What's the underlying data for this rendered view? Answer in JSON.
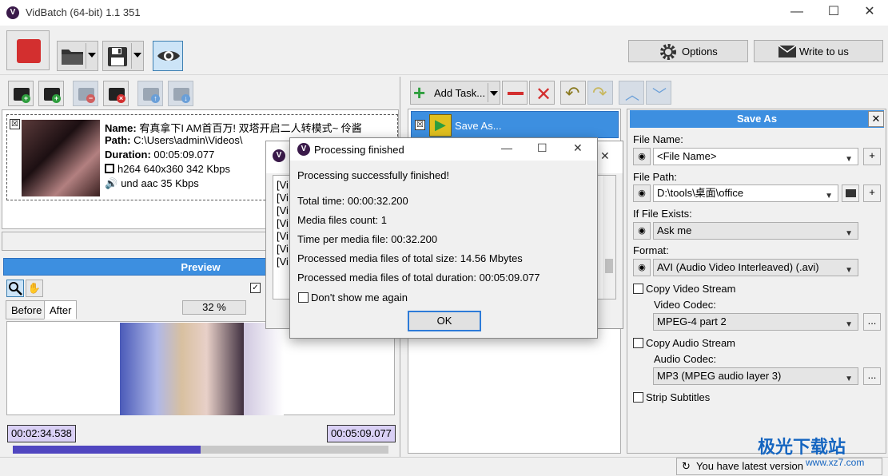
{
  "window": {
    "title": "VidBatch (64-bit) 1.1 351",
    "minimize": "—",
    "maximize": "☐",
    "close": "✕"
  },
  "toolbar": {
    "options_label": "Options",
    "write_label": "Write to us"
  },
  "media": {
    "name_label": "Name:",
    "name_value": "宥真拿下I AM首百万! 双塔开启二人转模式~ 伶酱",
    "path_label": "Path:",
    "path_value": "C:\\Users\\admin\\Videos\\",
    "duration_label": "Duration:",
    "duration_value": "00:05:09.077",
    "video_info": "h264 640x360 342 Kbps",
    "audio_info": "und aac 35 Kbps",
    "checked": "☒"
  },
  "preview": {
    "header": "Preview",
    "tab_before": "Before",
    "tab_after": "After",
    "zoom": "32 %",
    "start_time": "00:02:34.538",
    "end_time": "00:05:09.077",
    "progress_fraction": 0.5
  },
  "tasks": {
    "add_label": "Add Task...",
    "items": [
      {
        "label": "Save As..."
      }
    ]
  },
  "log_lines": [
    "[Vi",
    "[Vi",
    "[Vi",
    "[Vi",
    "[Vi",
    "[Vi",
    "[Vi"
  ],
  "saveas": {
    "header": "Save As",
    "file_name_label": "File Name:",
    "file_name_value": "<File Name>",
    "file_path_label": "File Path:",
    "file_path_value": "D:\\tools\\桌面\\office",
    "if_exists_label": "If File Exists:",
    "if_exists_value": "Ask me",
    "format_label": "Format:",
    "format_value": "AVI (Audio Video Interleaved) (.avi)",
    "copy_video_label": "Copy Video Stream",
    "video_codec_label": "Video Codec:",
    "video_codec_value": "MPEG-4 part 2",
    "copy_audio_label": "Copy Audio Stream",
    "audio_codec_label": "Audio Codec:",
    "audio_codec_value": "MP3 (MPEG audio layer 3)",
    "strip_subtitles_label": "Strip Subtitles",
    "more": "...",
    "plus": "+"
  },
  "dialog": {
    "title": "Processing finished",
    "message": "Processing successfully finished!",
    "total_time": "Total time: 00:00:32.200",
    "files_count": "Media files count: 1",
    "time_per_file": "Time per media file: 00:32.200",
    "total_size": "Processed media files of total size: 14.56 Mbytes",
    "total_duration": "Processed media files of total duration: 00:05:09.077",
    "dont_show": "Don't show me again",
    "ok": "OK"
  },
  "status": {
    "text": "You have latest version"
  },
  "watermark": {
    "brand": "极光下载站",
    "url": "www.xz7.com"
  },
  "colors": {
    "accent": "#3d8fe0",
    "stop": "#d32f2f",
    "progress": "#5046c0"
  }
}
